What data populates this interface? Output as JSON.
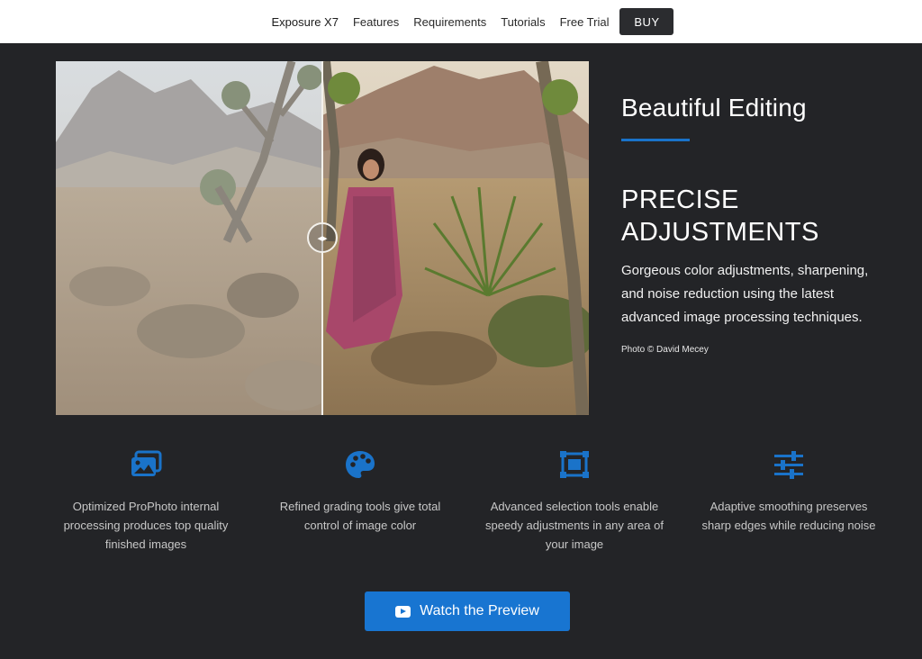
{
  "nav": {
    "items": [
      "Exposure X7",
      "Features",
      "Requirements",
      "Tutorials",
      "Free Trial"
    ],
    "buy_label": "BUY"
  },
  "hero": {
    "title": "Beautiful Editing",
    "heading_line1": "PRECISE",
    "heading_line2": "ADJUSTMENTS",
    "body": "Gorgeous color adjustments, sharpening, and noise reduction using the latest advanced image processing techniques.",
    "credit": "Photo © David Mecey",
    "handle_glyph": "◂▸"
  },
  "features": [
    {
      "icon": "images-icon",
      "text": "Optimized ProPhoto internal processing produces top quality finished images"
    },
    {
      "icon": "palette-icon",
      "text": "Refined grading tools give total control of image color"
    },
    {
      "icon": "object-group-icon",
      "text": "Advanced selection tools enable speedy adjustments in any area of your image"
    },
    {
      "icon": "sliders-icon",
      "text": "Adaptive smoothing preserves sharp edges while reducing noise"
    }
  ],
  "cta": {
    "label": "Watch the Preview",
    "icon": "youtube-icon"
  },
  "colors": {
    "background": "#232427",
    "accent": "#1a73c9",
    "cta": "#1875d1",
    "nav_bg": "#ffffff"
  }
}
